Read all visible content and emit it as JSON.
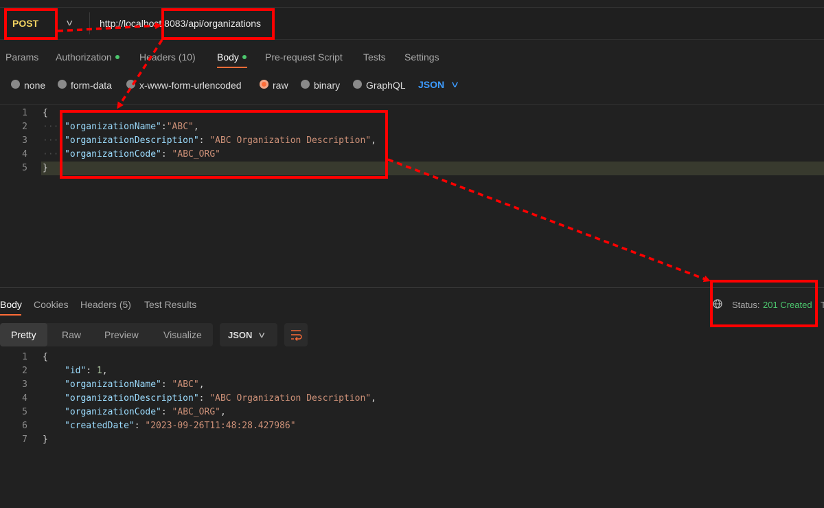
{
  "request": {
    "method": "POST",
    "url": "http://localhost:8083/api/organizations"
  },
  "request_tabs": [
    {
      "label": "Params"
    },
    {
      "label": "Authorization"
    },
    {
      "label": "Headers",
      "count": "(10)"
    },
    {
      "label": "Body"
    },
    {
      "label": "Pre-request Script"
    },
    {
      "label": "Tests"
    },
    {
      "label": "Settings"
    }
  ],
  "body_modes": [
    "none",
    "form-data",
    "x-www-form-urlencoded",
    "raw",
    "binary",
    "GraphQL"
  ],
  "body_format": "JSON",
  "request_body_lines": [
    "1",
    "2",
    "3",
    "4",
    "5"
  ],
  "request_body": {
    "l1": "{",
    "l2_key": "\"organizationName\"",
    "l2_val": "\"ABC\"",
    "l3_key": "\"organizationDescription\"",
    "l3_val": "\"ABC Organization Description\"",
    "l4_key": "\"organizationCode\"",
    "l4_val": "\"ABC_ORG\"",
    "l5": "}"
  },
  "response_tabs": [
    {
      "label": "Body"
    },
    {
      "label": "Cookies"
    },
    {
      "label": "Headers",
      "count": "(5)"
    },
    {
      "label": "Test Results"
    }
  ],
  "status": {
    "label": "Status:",
    "value": "201 Created"
  },
  "view_modes": [
    "Pretty",
    "Raw",
    "Preview",
    "Visualize"
  ],
  "response_format": "JSON",
  "response_body_lines": [
    "1",
    "2",
    "3",
    "4",
    "5",
    "6",
    "7"
  ],
  "response_body": {
    "l1": "{",
    "id_key": "\"id\"",
    "id_val": "1",
    "name_key": "\"organizationName\"",
    "name_val": "\"ABC\"",
    "desc_key": "\"organizationDescription\"",
    "desc_val": "\"ABC Organization Description\"",
    "code_key": "\"organizationCode\"",
    "code_val": "\"ABC_ORG\"",
    "date_key": "\"createdDate\"",
    "date_val": "\"2023-09-26T11:48:28.427986\"",
    "l7": "}"
  },
  "colors": {
    "accent": "#ff6c37",
    "annotation": "#ff0000",
    "success": "#4cc76e",
    "method": "#f2d361"
  }
}
